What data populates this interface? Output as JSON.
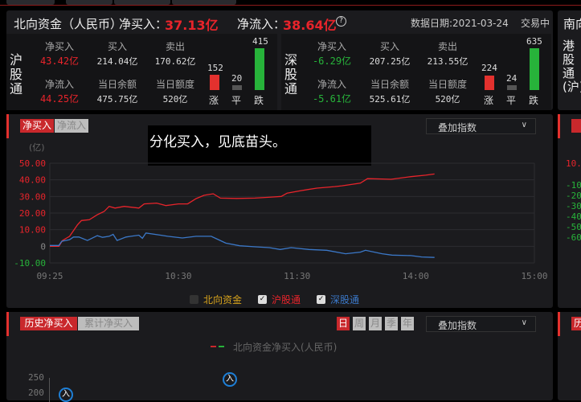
{
  "summary": {
    "title": "北向资金（人民币）",
    "net_buy_label": "净买入：",
    "net_buy_value": "37.13亿",
    "net_inflow_label": "净流入：",
    "net_inflow_value": "38.64亿",
    "date": "数据日期:2021-03-24",
    "status": "交易中",
    "sh": {
      "name": "沪股通",
      "net_buy_label": "净买入",
      "net_buy": "43.42亿",
      "buy_label": "买入",
      "buy": "214.04亿",
      "sell_label": "卖出",
      "sell": "170.62亿",
      "net_inflow_label": "净流入",
      "net_inflow": "44.25亿",
      "balance_label": "当日余额",
      "balance": "475.75亿",
      "quota_label": "当日额度",
      "quota": "520亿",
      "up": "152",
      "flat": "20",
      "down": "415",
      "up_label": "涨",
      "flat_label": "平",
      "down_label": "跌"
    },
    "sz": {
      "name": "深股通",
      "net_buy_label": "净买入",
      "net_buy": "-6.29亿",
      "buy_label": "买入",
      "buy": "207.25亿",
      "sell_label": "卖出",
      "sell": "213.55亿",
      "net_inflow_label": "净流入",
      "net_inflow": "-5.61亿",
      "balance_label": "当日余额",
      "balance": "525.61亿",
      "quota_label": "当日额度",
      "quota": "520亿",
      "up": "224",
      "flat": "24",
      "down": "635",
      "up_label": "涨",
      "flat_label": "平",
      "down_label": "跌"
    },
    "south_title": "南向",
    "hk_name": "港股通(沪)"
  },
  "intraday": {
    "tab_net_buy": "净买入",
    "tab_net_inflow": "净流入",
    "overlay": "叠加指数",
    "overlay_chevron": "∨",
    "caption": "分化买入，见底苗头。",
    "unit": "(亿)",
    "legend": [
      "北向资金",
      "沪股通",
      "深股通"
    ],
    "right_ticks": [
      "10.",
      "-10.",
      "-20.",
      "-30.",
      "-40.",
      "-50.",
      "-60."
    ]
  },
  "history": {
    "tab_history": "历史净买入",
    "tab_cum": "累计净买入",
    "periods": [
      "日",
      "周",
      "月",
      "季",
      "年"
    ],
    "overlay": "叠加指数",
    "overlay_chevron": "∨",
    "legend": "北向资金净买入(人民币)",
    "yticks": [
      "250",
      "200"
    ],
    "marker": "入",
    "right_tab": "历"
  },
  "chart_data": {
    "type": "line",
    "xlabel": "",
    "ylabel": "(亿)",
    "x_ticks": [
      "09:25",
      "10:30",
      "11:30",
      "14:00",
      "15:00"
    ],
    "x_tick_minutes": [
      0,
      65,
      125,
      185,
      245
    ],
    "y_ticks": [
      "50.00",
      "40.00",
      "30.00",
      "20.00",
      "10.00",
      "0",
      "-10.00"
    ],
    "ylim": [
      -10,
      50
    ],
    "xlim": [
      0,
      245
    ],
    "x_unit": "trading minutes since 09:25",
    "series": [
      {
        "name": "沪股通",
        "color": "#e8242b",
        "x": [
          0,
          4.6,
          6.4,
          10,
          14,
          16,
          20,
          24,
          27.5,
          30,
          33,
          37.6,
          45,
          47.7,
          54,
          58.7,
          65,
          69.7,
          74,
          78,
          82.6,
          86.2,
          94.5,
          103.7,
          113,
          117,
          120,
          127,
          135,
          144,
          147.7,
          157,
          160.6,
          168,
          172.5,
          182.6,
          190,
          194.5
        ],
        "y": [
          0,
          0,
          3.5,
          6,
          13,
          15.5,
          16,
          19,
          21,
          24,
          23,
          24,
          23,
          25.5,
          26,
          24.5,
          25.5,
          25.5,
          28.7,
          30.7,
          31.6,
          29,
          28.8,
          29,
          29.7,
          30,
          32,
          33.5,
          35,
          35.9,
          36.4,
          38,
          40.7,
          40.5,
          40.3,
          41.9,
          42.8,
          43.5
        ]
      },
      {
        "name": "深股通",
        "color": "#3b78c8",
        "x": [
          0,
          4.6,
          6,
          10,
          12,
          14.7,
          19,
          24,
          26.6,
          30,
          32,
          34,
          38.5,
          41,
          45,
          46.8,
          48.6,
          56,
          59.6,
          67,
          74,
          81.6,
          85.3,
          89,
          96,
          104,
          111,
          116.5,
          122,
          131,
          140,
          149.5,
          157,
          159.6,
          168,
          173,
          182.6,
          188,
          194.5
        ],
        "y": [
          0.5,
          0.5,
          3,
          4,
          5.6,
          5.6,
          3.5,
          6.4,
          5.4,
          6,
          7.2,
          3.5,
          5.6,
          6,
          6.7,
          4.8,
          8,
          6.7,
          6,
          5,
          6,
          6,
          4,
          1.9,
          0.3,
          -0.3,
          -0.8,
          -1.9,
          -0.8,
          -1.9,
          -2.4,
          -4.5,
          -3.5,
          -2.4,
          -4.5,
          -5.3,
          -5.6,
          -6.4,
          -6.7
        ]
      }
    ]
  }
}
